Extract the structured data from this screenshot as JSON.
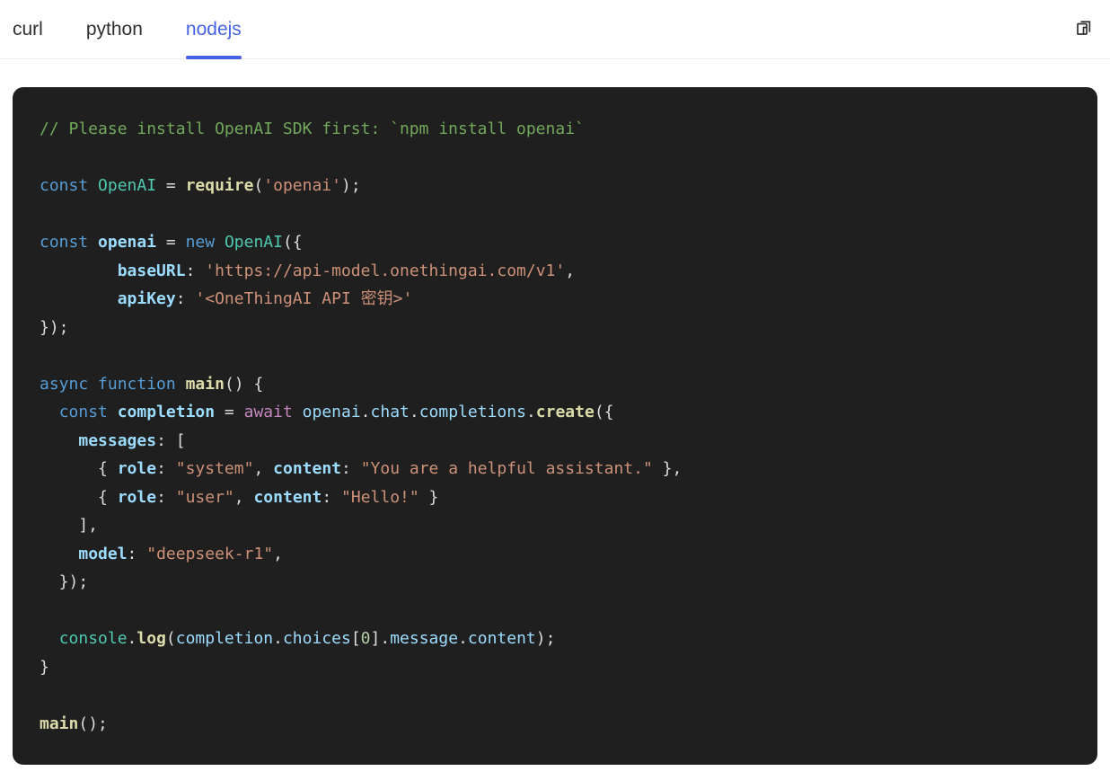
{
  "tabs": [
    {
      "label": "curl",
      "active": false
    },
    {
      "label": "python",
      "active": false
    },
    {
      "label": "nodejs",
      "active": true
    }
  ],
  "accent_color": "#4662e4",
  "copy_icon": "copy-pages",
  "code": {
    "language": "nodejs",
    "background": "#1f1f1f",
    "colors": {
      "com": "#72a85a",
      "kw": "#569cd6",
      "ctrl": "#c586c0",
      "cls": "#4ec9b0",
      "fn": "#dcdcaa",
      "var": "#9cdcfe",
      "str": "#ce9178",
      "num": "#b5cea8",
      "pun": "#dcdcdc"
    },
    "lines": [
      [
        {
          "t": "// Please install OpenAI SDK first: `npm install openai`",
          "c": "com"
        }
      ],
      [],
      [
        {
          "t": "const",
          "c": "kw"
        },
        {
          "t": " ",
          "c": "pun"
        },
        {
          "t": "OpenAI",
          "c": "cls"
        },
        {
          "t": " = ",
          "c": "pun"
        },
        {
          "t": "require",
          "c": "fn",
          "b": 1
        },
        {
          "t": "(",
          "c": "pun"
        },
        {
          "t": "'openai'",
          "c": "str"
        },
        {
          "t": ");",
          "c": "pun"
        }
      ],
      [],
      [
        {
          "t": "const",
          "c": "kw"
        },
        {
          "t": " ",
          "c": "pun"
        },
        {
          "t": "openai",
          "c": "var",
          "b": 1
        },
        {
          "t": " = ",
          "c": "pun"
        },
        {
          "t": "new",
          "c": "kw"
        },
        {
          "t": " ",
          "c": "pun"
        },
        {
          "t": "OpenAI",
          "c": "cls"
        },
        {
          "t": "({",
          "c": "pun"
        }
      ],
      [
        {
          "t": "        ",
          "c": "pun"
        },
        {
          "t": "baseURL",
          "c": "var",
          "b": 1
        },
        {
          "t": ": ",
          "c": "pun"
        },
        {
          "t": "'https://api-model.onethingai.com/v1'",
          "c": "str"
        },
        {
          "t": ",",
          "c": "pun"
        }
      ],
      [
        {
          "t": "        ",
          "c": "pun"
        },
        {
          "t": "apiKey",
          "c": "var",
          "b": 1
        },
        {
          "t": ": ",
          "c": "pun"
        },
        {
          "t": "'<OneThingAI API 密钥>'",
          "c": "str"
        }
      ],
      [
        {
          "t": "});",
          "c": "pun"
        }
      ],
      [],
      [
        {
          "t": "async",
          "c": "kw"
        },
        {
          "t": " ",
          "c": "pun"
        },
        {
          "t": "function",
          "c": "kw"
        },
        {
          "t": " ",
          "c": "pun"
        },
        {
          "t": "main",
          "c": "fn",
          "b": 1
        },
        {
          "t": "() {",
          "c": "pun"
        }
      ],
      [
        {
          "t": "  ",
          "c": "pun"
        },
        {
          "t": "const",
          "c": "kw"
        },
        {
          "t": " ",
          "c": "pun"
        },
        {
          "t": "completion",
          "c": "var",
          "b": 1
        },
        {
          "t": " = ",
          "c": "pun"
        },
        {
          "t": "await",
          "c": "ctrl"
        },
        {
          "t": " ",
          "c": "pun"
        },
        {
          "t": "openai",
          "c": "var"
        },
        {
          "t": ".",
          "c": "pun"
        },
        {
          "t": "chat",
          "c": "var"
        },
        {
          "t": ".",
          "c": "pun"
        },
        {
          "t": "completions",
          "c": "var"
        },
        {
          "t": ".",
          "c": "pun"
        },
        {
          "t": "create",
          "c": "fn",
          "b": 1
        },
        {
          "t": "({",
          "c": "pun"
        }
      ],
      [
        {
          "t": "    ",
          "c": "pun"
        },
        {
          "t": "messages",
          "c": "var",
          "b": 1
        },
        {
          "t": ": [",
          "c": "pun"
        }
      ],
      [
        {
          "t": "      { ",
          "c": "pun"
        },
        {
          "t": "role",
          "c": "var",
          "b": 1
        },
        {
          "t": ": ",
          "c": "pun"
        },
        {
          "t": "\"system\"",
          "c": "str"
        },
        {
          "t": ", ",
          "c": "pun"
        },
        {
          "t": "content",
          "c": "var",
          "b": 1
        },
        {
          "t": ": ",
          "c": "pun"
        },
        {
          "t": "\"You are a helpful assistant.\"",
          "c": "str"
        },
        {
          "t": " },",
          "c": "pun"
        }
      ],
      [
        {
          "t": "      { ",
          "c": "pun"
        },
        {
          "t": "role",
          "c": "var",
          "b": 1
        },
        {
          "t": ": ",
          "c": "pun"
        },
        {
          "t": "\"user\"",
          "c": "str"
        },
        {
          "t": ", ",
          "c": "pun"
        },
        {
          "t": "content",
          "c": "var",
          "b": 1
        },
        {
          "t": ": ",
          "c": "pun"
        },
        {
          "t": "\"Hello!\"",
          "c": "str"
        },
        {
          "t": " }",
          "c": "pun"
        }
      ],
      [
        {
          "t": "    ],",
          "c": "pun"
        }
      ],
      [
        {
          "t": "    ",
          "c": "pun"
        },
        {
          "t": "model",
          "c": "var",
          "b": 1
        },
        {
          "t": ": ",
          "c": "pun"
        },
        {
          "t": "\"deepseek-r1\"",
          "c": "str"
        },
        {
          "t": ",",
          "c": "pun"
        }
      ],
      [
        {
          "t": "  });",
          "c": "pun"
        }
      ],
      [],
      [
        {
          "t": "  ",
          "c": "pun"
        },
        {
          "t": "console",
          "c": "cls"
        },
        {
          "t": ".",
          "c": "pun"
        },
        {
          "t": "log",
          "c": "fn",
          "b": 1
        },
        {
          "t": "(",
          "c": "pun"
        },
        {
          "t": "completion",
          "c": "var"
        },
        {
          "t": ".",
          "c": "pun"
        },
        {
          "t": "choices",
          "c": "var"
        },
        {
          "t": "[",
          "c": "pun"
        },
        {
          "t": "0",
          "c": "num"
        },
        {
          "t": "]",
          "c": "pun"
        },
        {
          "t": ".",
          "c": "pun"
        },
        {
          "t": "message",
          "c": "var"
        },
        {
          "t": ".",
          "c": "pun"
        },
        {
          "t": "content",
          "c": "var"
        },
        {
          "t": ");",
          "c": "pun"
        }
      ],
      [
        {
          "t": "}",
          "c": "pun"
        }
      ],
      [],
      [
        {
          "t": "main",
          "c": "fn",
          "b": 1
        },
        {
          "t": "();",
          "c": "pun"
        }
      ]
    ]
  }
}
